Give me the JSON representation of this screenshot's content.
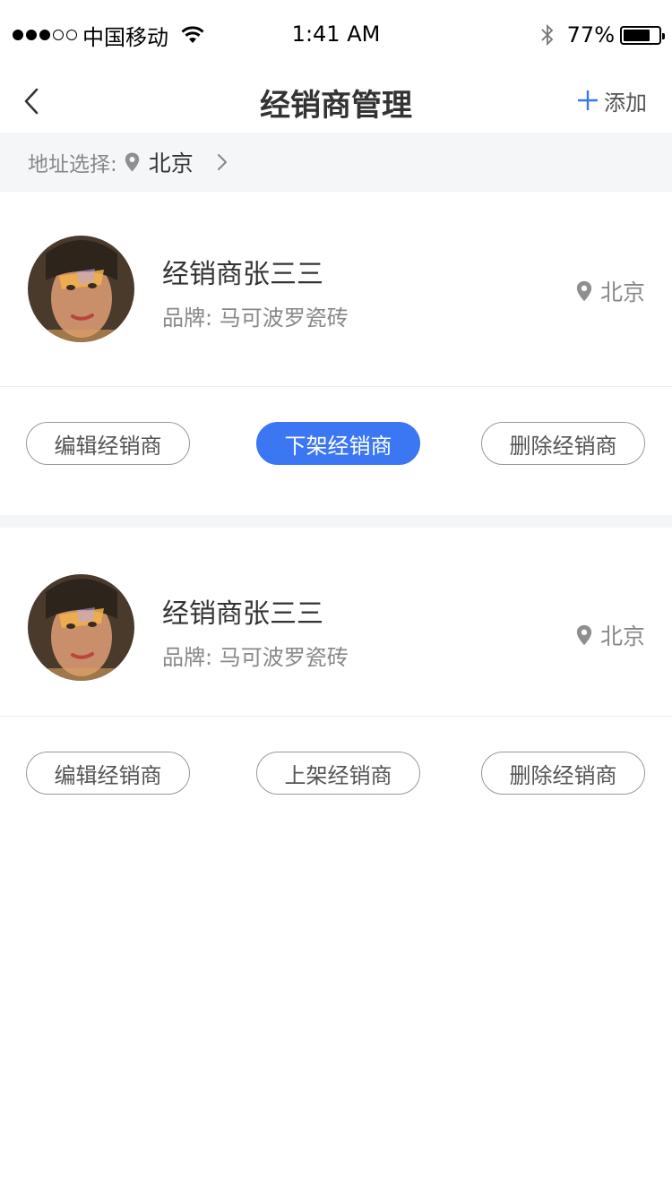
{
  "status_bar": {
    "carrier": "中国移动",
    "time": "1:41 AM",
    "battery_percent": "77%",
    "battery_level": 0.77,
    "signal_bars_filled": 3,
    "signal_bars_total": 5
  },
  "nav": {
    "title": "经销商管理",
    "add_label": "添加"
  },
  "address_filter": {
    "label": "地址选择:",
    "city": "北京"
  },
  "dealers": [
    {
      "name": "经销商张三三",
      "brand_label": "品牌:",
      "brand": "马可波罗瓷砖",
      "location": "北京",
      "actions": [
        "编辑经销商",
        "下架经销商",
        "删除经销商"
      ]
    },
    {
      "name": "经销商张三三",
      "brand_label": "品牌:",
      "brand": "马可波罗瓷砖",
      "location": "北京",
      "actions": [
        "编辑经销商",
        "上架经销商",
        "删除经销商"
      ]
    }
  ],
  "colors": {
    "accent": "#3b76f3",
    "section_bg": "#f5f6f8",
    "text_primary": "#333333",
    "text_secondary": "#888888"
  }
}
